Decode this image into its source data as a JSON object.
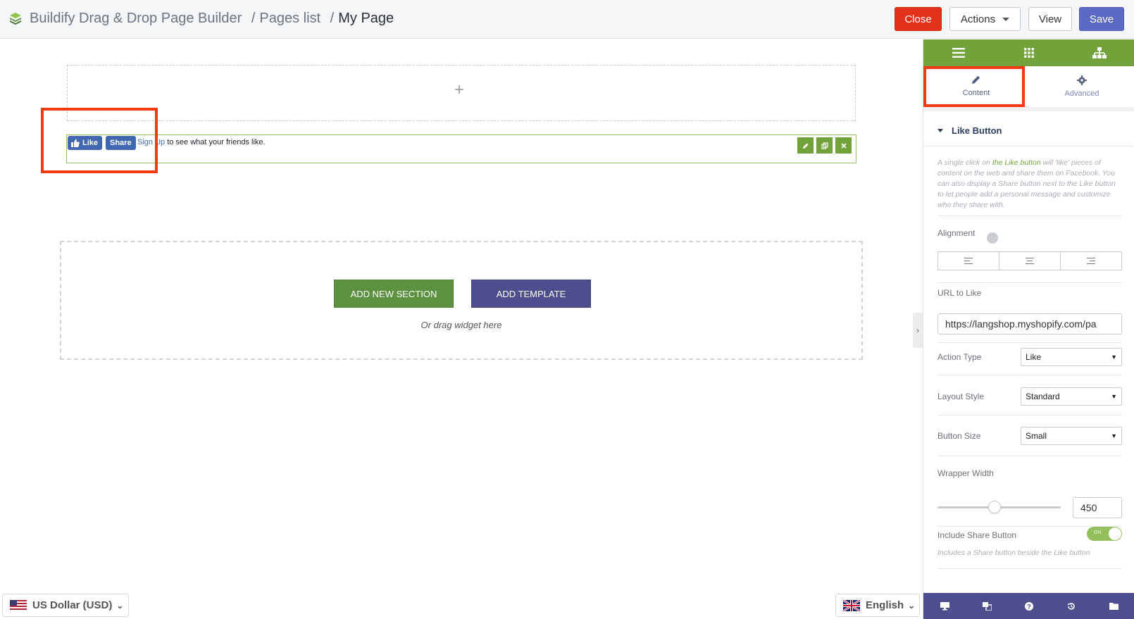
{
  "header": {
    "breadcrumbs": [
      "Buildify Drag & Drop Page Builder",
      "Pages list",
      "My Page"
    ],
    "separators": [
      "/",
      "/"
    ],
    "buttons": {
      "close": "Close",
      "actions": "Actions",
      "view": "View",
      "save": "Save"
    }
  },
  "canvas": {
    "add_icon": "+",
    "widget": {
      "like_label": "Like",
      "share_label": "Share",
      "signup_link": "Sign Up",
      "signup_text": " to see what your friends like."
    },
    "add_section_label": "ADD NEW SECTION",
    "add_template_label": "ADD TEMPLATE",
    "drag_hint": "Or drag widget here"
  },
  "footer_selectors": {
    "currency": "US Dollar (USD)",
    "language": "English"
  },
  "panel": {
    "tabs": {
      "content": "Content",
      "advanced": "Advanced"
    },
    "section_title": "Like Button",
    "description": {
      "before": "A single click on ",
      "link": "the Like button",
      "after": " will 'like' pieces of content on the web and share them on Facebook. You can also display a Share button next to the Like button to let people add a personal message and customize who they share with."
    },
    "fields": {
      "alignment_label": "Alignment",
      "url_label": "URL to Like",
      "url_value": "https://langshop.myshopify.com/pa",
      "action_type_label": "Action Type",
      "action_type_value": "Like",
      "layout_style_label": "Layout Style",
      "layout_style_value": "Standard",
      "button_size_label": "Button Size",
      "button_size_value": "Small",
      "wrapper_width_label": "Wrapper Width",
      "wrapper_width_value": "450",
      "wrapper_width_slider_fraction": 0.43,
      "include_share_label": "Include Share Button",
      "include_share_state": "ON",
      "include_share_hint": "Includes a Share button beside the Like button"
    }
  },
  "colors": {
    "accent_green": "#71a33a",
    "accent_purple": "#4e4d8d",
    "close_red": "#e3311a",
    "save_blue": "#5c6ac4",
    "highlight": "#f43a10"
  }
}
